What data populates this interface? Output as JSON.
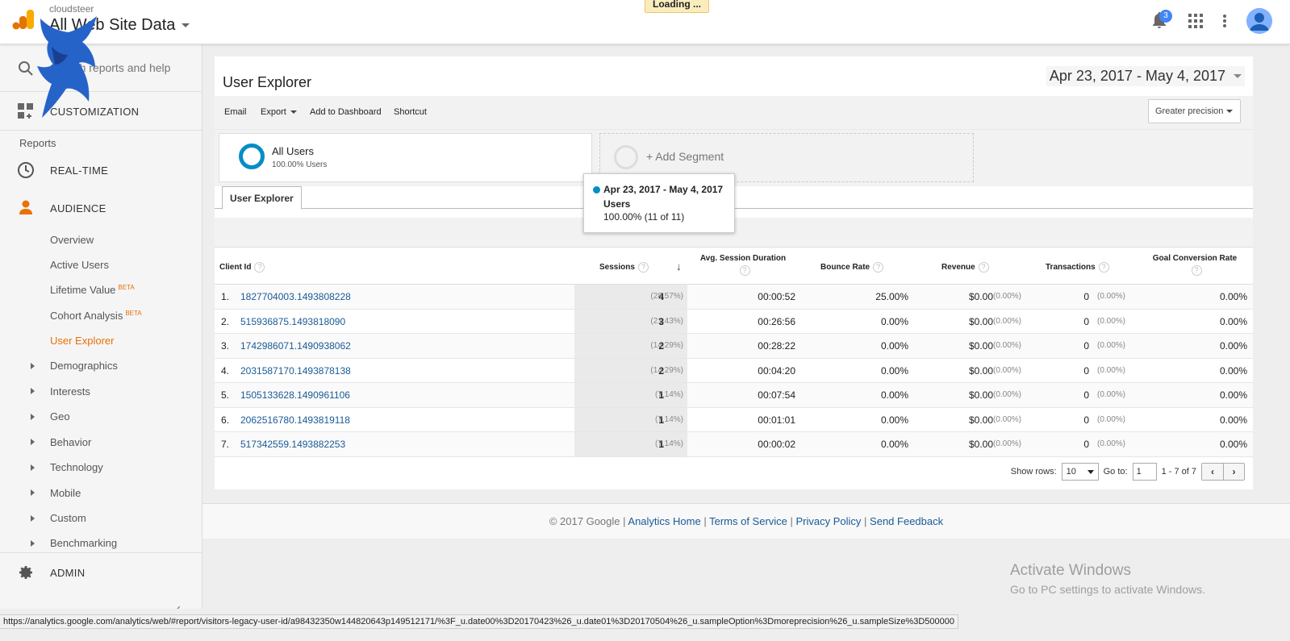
{
  "header": {
    "account": "cloudsteer",
    "property": "All Web Site Data",
    "loading": "Loading ...",
    "notification_count": "3"
  },
  "sidebar": {
    "search_placeholder": "Search reports and help",
    "customization": "CUSTOMIZATION",
    "reports_title": "Reports",
    "realtime": "REAL-TIME",
    "audience": "AUDIENCE",
    "sub_items": [
      {
        "label": "Overview"
      },
      {
        "label": "Active Users"
      },
      {
        "label": "Lifetime Value",
        "badge": "BETA"
      },
      {
        "label": "Cohort Analysis",
        "badge": "BETA"
      },
      {
        "label": "User Explorer",
        "active": true
      }
    ],
    "expandable": [
      "Demographics",
      "Interests",
      "Geo",
      "Behavior",
      "Technology",
      "Mobile",
      "Custom",
      "Benchmarking"
    ],
    "admin": "ADMIN"
  },
  "report": {
    "title": "User Explorer",
    "date_range": "Apr 23, 2017 - May 4, 2017",
    "toolbar": {
      "email": "Email",
      "export": "Export",
      "add_dashboard": "Add to Dashboard",
      "shortcut": "Shortcut",
      "precision": "Greater precision"
    },
    "segment": {
      "name": "All Users",
      "sub": "100.00% Users",
      "add": "+ Add Segment"
    },
    "tab": "User Explorer",
    "tooltip": {
      "date": "Apr 23, 2017 - May 4, 2017",
      "metric": "Users",
      "value": "100.00% (11 of 11)"
    }
  },
  "table": {
    "headers": {
      "client_id": "Client Id",
      "sessions": "Sessions",
      "avg_duration": "Avg. Session Duration",
      "bounce_rate": "Bounce Rate",
      "revenue": "Revenue",
      "transactions": "Transactions",
      "goal_conv": "Goal Conversion Rate"
    },
    "rows": [
      {
        "n": "1.",
        "id": "1827704003.1493808228",
        "sessions": "4",
        "sess_pct": "(28.57%)",
        "dur": "00:00:52",
        "bounce": "25.00%",
        "rev": "$0.00",
        "rev_pct": "(0.00%)",
        "trans": "0",
        "trans_pct": "(0.00%)",
        "goal": "0.00%"
      },
      {
        "n": "2.",
        "id": "515936875.1493818090",
        "sessions": "3",
        "sess_pct": "(21.43%)",
        "dur": "00:26:56",
        "bounce": "0.00%",
        "rev": "$0.00",
        "rev_pct": "(0.00%)",
        "trans": "0",
        "trans_pct": "(0.00%)",
        "goal": "0.00%"
      },
      {
        "n": "3.",
        "id": "1742986071.1490938062",
        "sessions": "2",
        "sess_pct": "(14.29%)",
        "dur": "00:28:22",
        "bounce": "0.00%",
        "rev": "$0.00",
        "rev_pct": "(0.00%)",
        "trans": "0",
        "trans_pct": "(0.00%)",
        "goal": "0.00%"
      },
      {
        "n": "4.",
        "id": "2031587170.1493878138",
        "sessions": "2",
        "sess_pct": "(14.29%)",
        "dur": "00:04:20",
        "bounce": "0.00%",
        "rev": "$0.00",
        "rev_pct": "(0.00%)",
        "trans": "0",
        "trans_pct": "(0.00%)",
        "goal": "0.00%"
      },
      {
        "n": "5.",
        "id": "1505133628.1490961106",
        "sessions": "1",
        "sess_pct": "(7.14%)",
        "dur": "00:07:54",
        "bounce": "0.00%",
        "rev": "$0.00",
        "rev_pct": "(0.00%)",
        "trans": "0",
        "trans_pct": "(0.00%)",
        "goal": "0.00%"
      },
      {
        "n": "6.",
        "id": "2062516780.1493819118",
        "sessions": "1",
        "sess_pct": "(7.14%)",
        "dur": "00:01:01",
        "bounce": "0.00%",
        "rev": "$0.00",
        "rev_pct": "(0.00%)",
        "trans": "0",
        "trans_pct": "(0.00%)",
        "goal": "0.00%"
      },
      {
        "n": "7.",
        "id": "517342559.1493882253",
        "sessions": "1",
        "sess_pct": "(7.14%)",
        "dur": "00:00:02",
        "bounce": "0.00%",
        "rev": "$0.00",
        "rev_pct": "(0.00%)",
        "trans": "0",
        "trans_pct": "(0.00%)",
        "goal": "0.00%"
      }
    ],
    "pager": {
      "show_rows_label": "Show rows:",
      "show_rows_value": "10",
      "goto_label": "Go to:",
      "goto_value": "1",
      "range": "1 - 7 of 7",
      "prev": "‹",
      "next": "›"
    }
  },
  "footer": {
    "copyright": "© 2017 Google",
    "links": [
      "Analytics Home",
      "Terms of Service",
      "Privacy Policy",
      "Send Feedback"
    ]
  },
  "watermark": {
    "title": "Activate Windows",
    "sub": "Go to PC settings to activate Windows."
  },
  "status_url": "https://analytics.google.com/analytics/web/#report/visitors-legacy-user-id/a98432350w144820643p149512171/%3F_u.date00%3D20170423%26_u.date01%3D20170504%26_u.sampleOption%3Dmoreprecision%26_u.sampleSize%3D500000",
  "colors": {
    "accent_orange": "#e8710a",
    "segment_blue": "#058dc7",
    "link_blue": "#1a5a96"
  }
}
